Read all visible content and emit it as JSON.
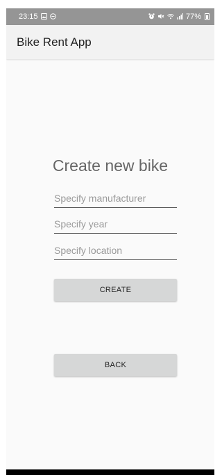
{
  "status_bar": {
    "time": "23:15",
    "left_icons": [
      "gallery-icon",
      "do-not-disturb-icon"
    ],
    "right_icons": [
      "alarm-icon",
      "mute-icon",
      "wifi-icon",
      "signal-icon",
      "battery-icon"
    ],
    "battery_text": "77%"
  },
  "app_bar": {
    "title": "Bike Rent App"
  },
  "form": {
    "heading": "Create new bike",
    "manufacturer": {
      "value": "",
      "placeholder": "Specify manufacturer"
    },
    "year": {
      "value": "",
      "placeholder": "Specify year"
    },
    "location": {
      "value": "",
      "placeholder": "Specify location"
    },
    "create_label": "CREATE",
    "back_label": "BACK"
  },
  "colors": {
    "status_bar_bg": "#959595",
    "app_bar_bg": "#f2f2f2",
    "background": "#fafafa",
    "button_bg": "#d6d7d7",
    "heading_text": "#666666"
  }
}
